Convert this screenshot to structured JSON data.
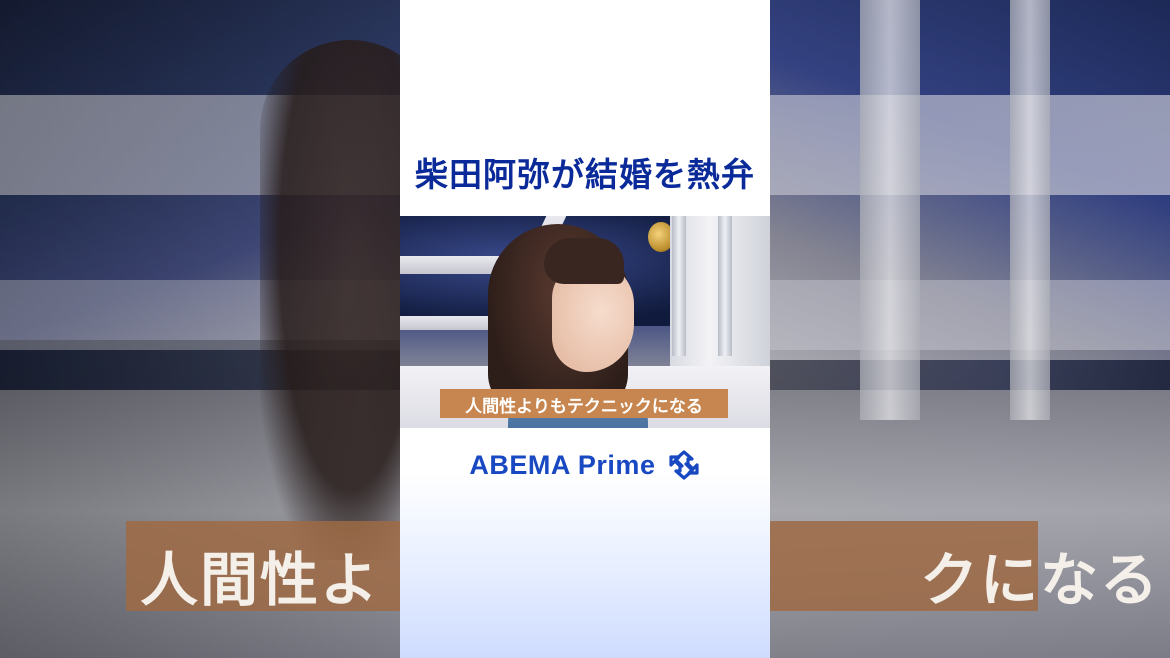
{
  "video": {
    "title": "柴田阿弥が結婚を熱弁",
    "caption": "人間性よりもテクニックになる",
    "brand": "ABEMA Prime",
    "brand_icon": "refresh-loop-icon"
  },
  "background": {
    "caption_left": "人間性よ",
    "caption_right": "クになる"
  },
  "colors": {
    "title": "#0a2a9a",
    "caption_bg": "#c7864f",
    "brand": "#1848c2"
  }
}
